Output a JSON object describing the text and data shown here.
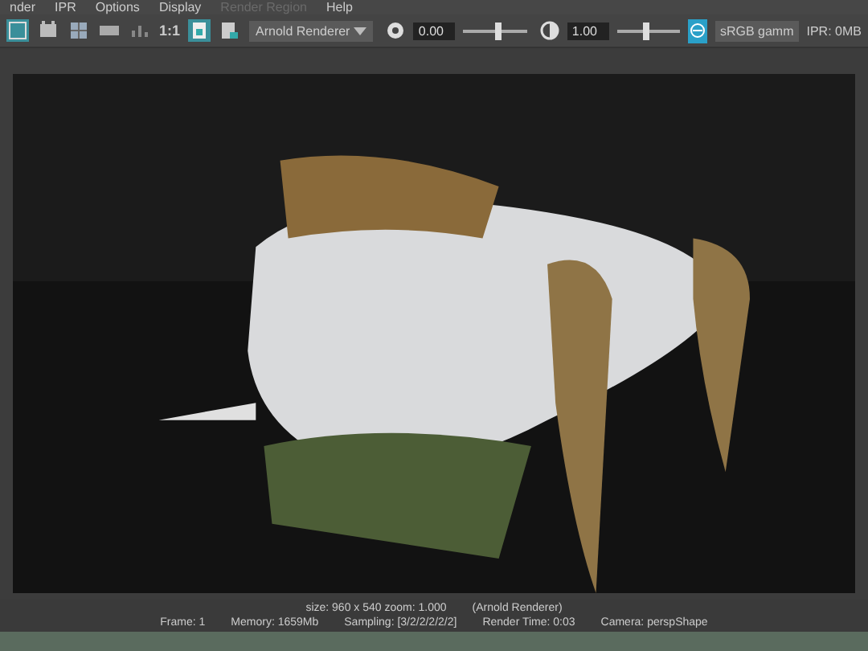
{
  "menu_bar": [
    {
      "label": "nder",
      "disabled": false
    },
    {
      "label": "IPR",
      "disabled": false
    },
    {
      "label": "Options",
      "disabled": false
    },
    {
      "label": "Display",
      "disabled": false
    },
    {
      "label": "Render Region",
      "disabled": true
    },
    {
      "label": "Help",
      "disabled": false
    }
  ],
  "toolbar": {
    "tools": [
      {
        "kind": "frame",
        "on": true
      },
      {
        "kind": "film",
        "on": false
      },
      {
        "kind": "grid",
        "on": false
      },
      {
        "kind": "rgb",
        "on": false
      },
      {
        "kind": "bars",
        "on": false
      }
    ],
    "ratio": "1:1",
    "toggles": [
      {
        "kind": "snapshot",
        "on": true
      },
      {
        "kind": "album",
        "on": false
      }
    ],
    "renderer": "Arnold Renderer",
    "exposure": {
      "value": "0.00",
      "level": 0.55
    },
    "gamma": {
      "value": "1.00",
      "level": 0.45
    },
    "color_space_on": true,
    "view_transform": "sRGB gamm",
    "ipr_memory": "IPR: 0MB"
  },
  "status_bar": {
    "line_1": [
      "size: 960 x 540 zoom: 1.000",
      "(Arnold Renderer)"
    ],
    "line_2": [
      "Frame: 1",
      "Memory: 1659Mb",
      "Sampling: [3/2/2/2/2/2]",
      "Render Time: 0:03",
      "Camera: perspShape"
    ]
  }
}
